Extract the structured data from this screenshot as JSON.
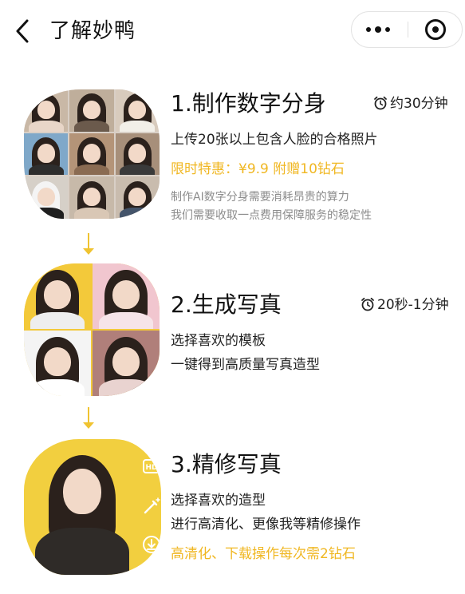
{
  "header": {
    "title": "了解妙鸭",
    "back_icon": "chevron-left-icon",
    "more_icon": "more-dots-icon",
    "close_icon": "mini-program-close-icon"
  },
  "colors": {
    "accent": "#f0b722",
    "arrow": "#f0c330",
    "note": "#8c8c8c",
    "text": "#222222"
  },
  "steps": [
    {
      "title": "1.制作数字分身",
      "duration": "约30分钟",
      "lines": [
        "上传20张以上包含人脸的合格照片"
      ],
      "highlight": "限时特惠：¥9.9 附赠10钻石",
      "notes": [
        "制作AI数字分身需要消耗昂贵的算力",
        "我们需要收取一点费用保障服务的稳定性"
      ]
    },
    {
      "title": "2.生成写真",
      "duration": "20秒-1分钟",
      "lines": [
        "选择喜欢的模板",
        "一键得到高质量写真造型"
      ]
    },
    {
      "title": "3.精修写真",
      "lines": [
        "选择喜欢的造型",
        "进行高清化、更像我等精修操作"
      ],
      "highlight": "高清化、下载操作每次需2钻石",
      "tools": [
        {
          "icon": "hd-icon",
          "label": "HD"
        },
        {
          "icon": "magic-wand-icon"
        },
        {
          "icon": "download-icon"
        }
      ]
    }
  ]
}
